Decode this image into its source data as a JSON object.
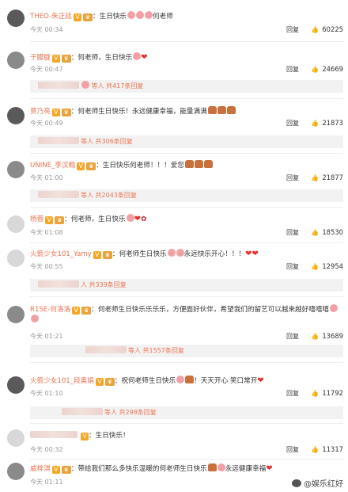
{
  "comments": [
    {
      "name": "THEO-朱正廷",
      "text": "：生日快乐",
      "text_tail": "何老师",
      "time": "今天 00:34",
      "reply": "回复",
      "likes": "60225",
      "reply_count": ""
    },
    {
      "name": "于朦胧",
      "text": "：何老师，生日快乐",
      "text_tail": "",
      "time": "今天 00:47",
      "reply": "回复",
      "likes": "24669",
      "reply_count": "等人 共417条回复"
    },
    {
      "name": "贾乃亮",
      "text": "：何老师生日快乐！永远健康幸福，能量满满",
      "text_tail": "",
      "time": "今天 00:49",
      "reply": "回复",
      "likes": "21873",
      "reply_count": "等人 共306条回复"
    },
    {
      "name": "UNINE_李汶翰",
      "text": "：生日快乐何老师！！！爱您",
      "text_tail": "",
      "time": "今天 01:00",
      "reply": "回复",
      "likes": "21877",
      "reply_count": "等人 共2043条回复"
    },
    {
      "name": "杨蓉",
      "text": "：何老师，生日快乐",
      "text_tail": "",
      "time": "今天 01:08",
      "reply": "回复",
      "likes": "18530",
      "reply_count": ""
    },
    {
      "name": "火箭少女101_Yamy",
      "text": "：何老师生日快乐",
      "text_tail": "永远快乐开心！！！",
      "time": "今天 00:55",
      "reply": "回复",
      "likes": "12954",
      "reply_count": "人 共339条回复"
    },
    {
      "name": "R1SE-何洛洛",
      "text": "：何老师生日快乐乐乐乐，方便面好伙伴，希望我们的留艺可以越来越好嘻嘻嘻",
      "text_tail": "",
      "time": "今天 01:21",
      "reply": "回复",
      "likes": "13689",
      "reply_count": "等人 共1557条回复"
    },
    {
      "name": "火箭少女101_段奥娟",
      "text": "：祝何老师生日快乐",
      "text_tail": "！天天开心 笑口常开",
      "time": "今天 01:10",
      "reply": "回复",
      "likes": "11792",
      "reply_count": "等人 共298条回复"
    },
    {
      "name": "",
      "text": "：生日快乐！",
      "text_tail": "",
      "time": "今天 00:32",
      "reply": "回复",
      "likes": "11317",
      "reply_count": ""
    },
    {
      "name": "戚梓淇",
      "text": "：带给我们那么多快乐温暖的何老师生日快乐",
      "text_tail": "永远健康幸福",
      "time": "今天 01:11",
      "reply": "回复",
      "likes": "",
      "reply_count": ""
    }
  ],
  "watermark": "@娱乐红好"
}
